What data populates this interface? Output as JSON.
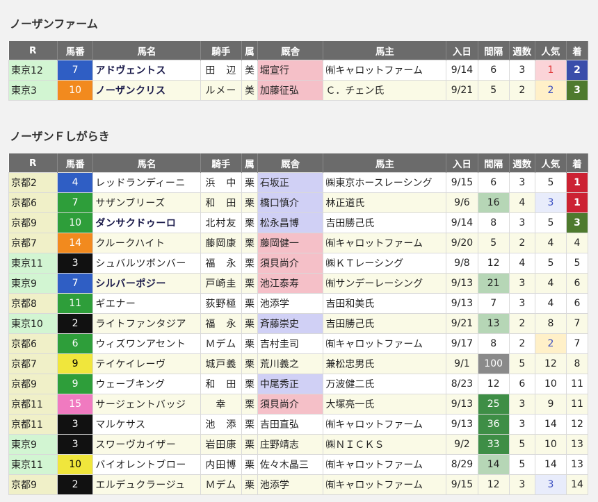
{
  "sections": [
    {
      "title": "ノーザンファーム",
      "headers": [
        "R",
        "馬番",
        "馬名",
        "騎手",
        "属",
        "厩舎",
        "馬主",
        "入日",
        "間隔",
        "週数",
        "人気",
        "着"
      ],
      "rows": [
        {
          "race": "東京12",
          "rc": "tokyo",
          "num": "7",
          "hc": 4,
          "horse": "アドヴェントス",
          "bold": true,
          "jockey": "田　辺",
          "belong": "美",
          "trainer": "堀宣行",
          "tc": "east",
          "owner": "㈲キャロットファーム",
          "date": "9/14",
          "interval": "6",
          "ic": "",
          "weeks": "3",
          "pop": "1",
          "pc": "p1",
          "finish": "2",
          "fc": "f2"
        },
        {
          "race": "東京3",
          "rc": "tokyo",
          "num": "10",
          "hc": 7,
          "horse": "ノーザンクリス",
          "bold": true,
          "jockey": "ルメー",
          "belong": "美",
          "trainer": "加藤征弘",
          "tc": "east",
          "owner": "Ｃ．チェン氏",
          "date": "9/21",
          "interval": "5",
          "ic": "",
          "weeks": "2",
          "pop": "2",
          "pc": "p2",
          "finish": "3",
          "fc": "f3"
        }
      ]
    },
    {
      "title": "ノーザンＦしがらき",
      "headers": [
        "R",
        "馬番",
        "馬名",
        "騎手",
        "属",
        "厩舎",
        "馬主",
        "入日",
        "間隔",
        "週数",
        "人気",
        "着"
      ],
      "rows": [
        {
          "race": "京都2",
          "rc": "kyoto",
          "num": "4",
          "hc": 4,
          "horse": "レッドランディーニ",
          "bold": false,
          "jockey": "浜　中",
          "belong": "栗",
          "trainer": "石坂正",
          "tc": "west",
          "owner": "㈱東京ホースレーシング",
          "date": "9/15",
          "interval": "6",
          "ic": "",
          "weeks": "3",
          "pop": "5",
          "pc": "",
          "finish": "1",
          "fc": "f1"
        },
        {
          "race": "京都6",
          "rc": "kyoto",
          "num": "7",
          "hc": 6,
          "horse": "サザンブリーズ",
          "bold": false,
          "jockey": "和　田",
          "belong": "栗",
          "trainer": "橋口慎介",
          "tc": "west",
          "owner": "林正道氏",
          "date": "9/6",
          "interval": "16",
          "ic": "g1",
          "weeks": "4",
          "pop": "3",
          "pc": "p3",
          "finish": "1",
          "fc": "f1"
        },
        {
          "race": "京都9",
          "rc": "kyoto",
          "num": "10",
          "hc": 6,
          "horse": "ダンサクドゥーロ",
          "bold": true,
          "jockey": "北村友",
          "belong": "栗",
          "trainer": "松永昌博",
          "tc": "west",
          "owner": "吉田勝己氏",
          "date": "9/14",
          "interval": "8",
          "ic": "",
          "weeks": "3",
          "pop": "5",
          "pc": "",
          "finish": "3",
          "fc": "f3"
        },
        {
          "race": "京都7",
          "rc": "kyoto",
          "num": "14",
          "hc": 7,
          "horse": "クルークハイト",
          "bold": false,
          "jockey": "藤岡康",
          "belong": "栗",
          "trainer": "藤岡健一",
          "tc": "east",
          "owner": "㈲キャロットファーム",
          "date": "9/20",
          "interval": "5",
          "ic": "",
          "weeks": "2",
          "pop": "4",
          "pc": "",
          "finish": "4",
          "fc": ""
        },
        {
          "race": "東京11",
          "rc": "tokyo",
          "num": "3",
          "hc": 2,
          "horse": "シュバルツボンバー",
          "bold": false,
          "jockey": "福　永",
          "belong": "栗",
          "trainer": "須貝尚介",
          "tc": "east",
          "owner": "㈱ＫＴレーシング",
          "date": "9/8",
          "interval": "12",
          "ic": "",
          "weeks": "4",
          "pop": "5",
          "pc": "",
          "finish": "5",
          "fc": ""
        },
        {
          "race": "東京9",
          "rc": "tokyo",
          "num": "7",
          "hc": 4,
          "horse": "シルバーポジー",
          "bold": true,
          "jockey": "戸崎圭",
          "belong": "栗",
          "trainer": "池江泰寿",
          "tc": "east",
          "owner": "㈲サンデーレーシング",
          "date": "9/13",
          "interval": "21",
          "ic": "g1",
          "weeks": "3",
          "pop": "4",
          "pc": "",
          "finish": "6",
          "fc": ""
        },
        {
          "race": "京都8",
          "rc": "kyoto",
          "num": "11",
          "hc": 6,
          "horse": "ギエナー",
          "bold": false,
          "jockey": "荻野極",
          "belong": "栗",
          "trainer": "池添学",
          "tc": "",
          "owner": "吉田和美氏",
          "date": "9/13",
          "interval": "7",
          "ic": "",
          "weeks": "3",
          "pop": "4",
          "pc": "",
          "finish": "6",
          "fc": ""
        },
        {
          "race": "東京10",
          "rc": "tokyo",
          "num": "2",
          "hc": 2,
          "horse": "ライトファンタジア",
          "bold": false,
          "jockey": "福　永",
          "belong": "栗",
          "trainer": "斉藤崇史",
          "tc": "west",
          "owner": "吉田勝己氏",
          "date": "9/21",
          "interval": "13",
          "ic": "g1",
          "weeks": "2",
          "pop": "8",
          "pc": "",
          "finish": "7",
          "fc": ""
        },
        {
          "race": "京都6",
          "rc": "kyoto",
          "num": "6",
          "hc": 6,
          "horse": "ウィズワンアセント",
          "bold": false,
          "jockey": "Ｍデム",
          "belong": "栗",
          "trainer": "吉村圭司",
          "tc": "",
          "owner": "㈲キャロットファーム",
          "date": "9/17",
          "interval": "8",
          "ic": "",
          "weeks": "2",
          "pop": "2",
          "pc": "p2",
          "finish": "7",
          "fc": ""
        },
        {
          "race": "京都7",
          "rc": "kyoto",
          "num": "9",
          "hc": 5,
          "horse": "テイケイレーヴ",
          "bold": false,
          "jockey": "城戸義",
          "belong": "栗",
          "trainer": "荒川義之",
          "tc": "",
          "owner": "兼松忠男氏",
          "date": "9/1",
          "interval": "100",
          "ic": "g3",
          "weeks": "5",
          "pop": "12",
          "pc": "",
          "finish": "8",
          "fc": ""
        },
        {
          "race": "京都9",
          "rc": "kyoto",
          "num": "9",
          "hc": 6,
          "horse": "ウェーブキング",
          "bold": false,
          "jockey": "和　田",
          "belong": "栗",
          "trainer": "中尾秀正",
          "tc": "west",
          "owner": "万波健二氏",
          "date": "8/23",
          "interval": "12",
          "ic": "",
          "weeks": "6",
          "pop": "10",
          "pc": "",
          "finish": "11",
          "fc": ""
        },
        {
          "race": "京都11",
          "rc": "kyoto",
          "num": "15",
          "hc": 8,
          "horse": "サージェントバッジ",
          "bold": false,
          "jockey": "幸",
          "belong": "栗",
          "trainer": "須貝尚介",
          "tc": "east",
          "owner": "大塚亮一氏",
          "date": "9/13",
          "interval": "25",
          "ic": "g2",
          "weeks": "3",
          "pop": "9",
          "pc": "",
          "finish": "11",
          "fc": ""
        },
        {
          "race": "京都11",
          "rc": "kyoto",
          "num": "3",
          "hc": 2,
          "horse": "マルケサス",
          "bold": false,
          "jockey": "池　添",
          "belong": "栗",
          "trainer": "吉田直弘",
          "tc": "",
          "owner": "㈲キャロットファーム",
          "date": "9/13",
          "interval": "36",
          "ic": "g2",
          "weeks": "3",
          "pop": "14",
          "pc": "",
          "finish": "12",
          "fc": ""
        },
        {
          "race": "東京9",
          "rc": "tokyo",
          "num": "3",
          "hc": 2,
          "horse": "スワーヴカイザー",
          "bold": false,
          "jockey": "岩田康",
          "belong": "栗",
          "trainer": "庄野靖志",
          "tc": "",
          "owner": "㈱ＮＩＣＫＳ",
          "date": "9/2",
          "interval": "33",
          "ic": "g2",
          "weeks": "5",
          "pop": "10",
          "pc": "",
          "finish": "13",
          "fc": ""
        },
        {
          "race": "東京11",
          "rc": "tokyo",
          "num": "10",
          "hc": 5,
          "horse": "バイオレントブロー",
          "bold": false,
          "jockey": "内田博",
          "belong": "栗",
          "trainer": "佐々木晶三",
          "tc": "",
          "owner": "㈲キャロットファーム",
          "date": "8/29",
          "interval": "14",
          "ic": "g1",
          "weeks": "5",
          "pop": "14",
          "pc": "",
          "finish": "13",
          "fc": ""
        },
        {
          "race": "京都9",
          "rc": "kyoto",
          "num": "2",
          "hc": 2,
          "horse": "エルデュクラージュ",
          "bold": false,
          "jockey": "Ｍデム",
          "belong": "栗",
          "trainer": "池添学",
          "tc": "",
          "owner": "㈲キャロットファーム",
          "date": "9/15",
          "interval": "12",
          "ic": "",
          "weeks": "3",
          "pop": "3",
          "pc": "p3",
          "finish": "14",
          "fc": ""
        }
      ]
    }
  ]
}
